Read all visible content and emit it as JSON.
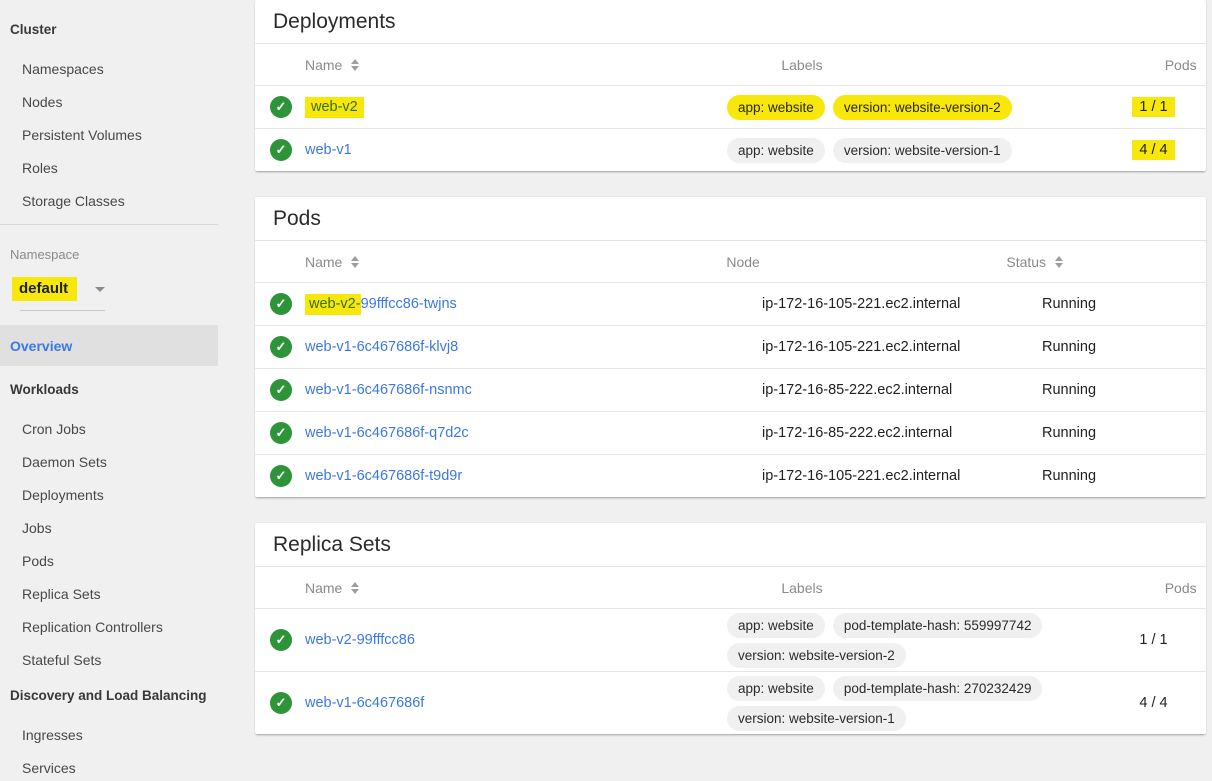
{
  "colors": {
    "highlight": "#f7e70a",
    "link_blue": "#3b78e7",
    "status_ok_green": "#2d9437"
  },
  "sidebar": {
    "cluster": {
      "header": "Cluster",
      "items": [
        "Namespaces",
        "Nodes",
        "Persistent Volumes",
        "Roles",
        "Storage Classes"
      ]
    },
    "namespace": {
      "label": "Namespace",
      "value": "default"
    },
    "overview_label": "Overview",
    "workloads": {
      "header": "Workloads",
      "items": [
        "Cron Jobs",
        "Daemon Sets",
        "Deployments",
        "Jobs",
        "Pods",
        "Replica Sets",
        "Replication Controllers",
        "Stateful Sets"
      ]
    },
    "discovery": {
      "header": "Discovery and Load Balancing",
      "items": [
        "Ingresses",
        "Services"
      ]
    }
  },
  "deployments": {
    "title": "Deployments",
    "columns": {
      "name": "Name",
      "labels": "Labels",
      "pods": "Pods"
    },
    "rows": [
      {
        "name": "web-v2",
        "labels": [
          "app: website",
          "version: website-version-2"
        ],
        "pods": "1 / 1"
      },
      {
        "name": "web-v1",
        "labels": [
          "app: website",
          "version: website-version-1"
        ],
        "pods": "4 / 4"
      }
    ]
  },
  "pods": {
    "title": "Pods",
    "columns": {
      "name": "Name",
      "node": "Node",
      "status": "Status"
    },
    "rows": [
      {
        "name_hl": "web-v2-",
        "name_rest": "99fffcc86-twjns",
        "node": "ip-172-16-105-221.ec2.internal",
        "status": "Running"
      },
      {
        "name": "web-v1-6c467686f-klvj8",
        "node": "ip-172-16-105-221.ec2.internal",
        "status": "Running"
      },
      {
        "name": "web-v1-6c467686f-nsnmc",
        "node": "ip-172-16-85-222.ec2.internal",
        "status": "Running"
      },
      {
        "name": "web-v1-6c467686f-q7d2c",
        "node": "ip-172-16-85-222.ec2.internal",
        "status": "Running"
      },
      {
        "name": "web-v1-6c467686f-t9d9r",
        "node": "ip-172-16-105-221.ec2.internal",
        "status": "Running"
      }
    ]
  },
  "replicasets": {
    "title": "Replica Sets",
    "columns": {
      "name": "Name",
      "labels": "Labels",
      "pods": "Pods"
    },
    "rows": [
      {
        "name": "web-v2-99fffcc86",
        "labels": [
          "app: website",
          "pod-template-hash: 559997742",
          "version: website-version-2"
        ],
        "pods": "1 / 1"
      },
      {
        "name": "web-v1-6c467686f",
        "labels": [
          "app: website",
          "pod-template-hash: 270232429",
          "version: website-version-1"
        ],
        "pods": "4 / 4"
      }
    ]
  }
}
